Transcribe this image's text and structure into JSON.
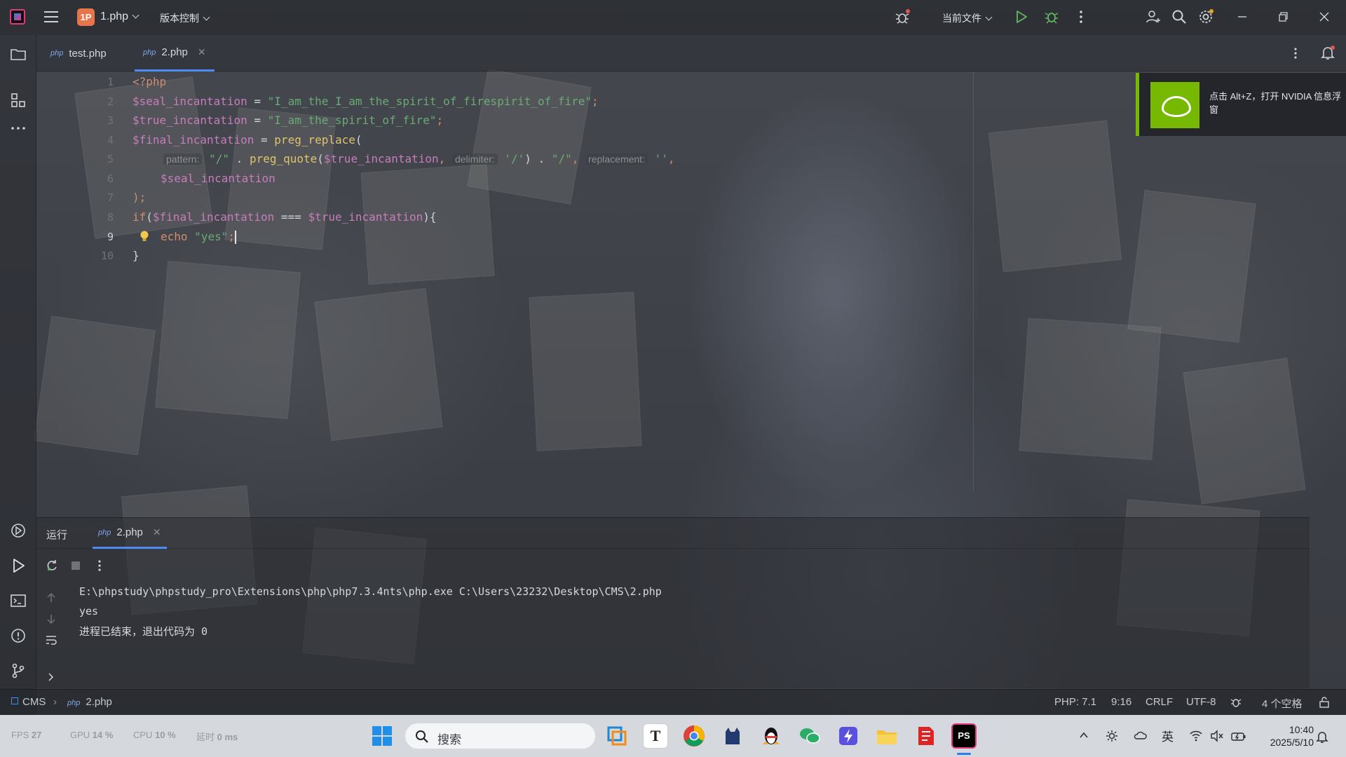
{
  "titlebar": {
    "project_badge": "1P",
    "project_name": "1.php",
    "vcs_label": "版本控制",
    "run_config": "当前文件"
  },
  "editor_tabs": [
    {
      "icon": "php",
      "label": "test.php"
    },
    {
      "icon": "php",
      "label": "2.php"
    }
  ],
  "editor": {
    "line_numbers": [
      "1",
      "2",
      "3",
      "4",
      "5",
      "6",
      "7",
      "8",
      "9",
      "10"
    ],
    "lines": [
      "<?php",
      "$seal_incantation = \"I_am_the_I_am_the_spirit_of_firespirit_of_fire\";",
      "$true_incantation = \"I_am_the_spirit_of_fire\";",
      "$final_incantation = preg_replace(",
      "pattern: \"/\" . preg_quote($true_incantation, delimiter: '/') . \"/\", replacement: '',",
      "$seal_incantation",
      ");",
      "if($final_incantation === $true_incantation){",
      "echo \"yes\";",
      "}"
    ],
    "tokens": {
      "php_open": "<?php",
      "seal_var": "$seal_incantation",
      "true_var": "$true_incantation",
      "final_var": "$final_incantation",
      "eq": " = ",
      "seal_str": "\"I_am_the_I_am_the_spirit_of_firespirit_of_fire\"",
      "true_str": "\"I_am_the_spirit_of_fire\"",
      "semi": ";",
      "preg_replace": "preg_replace",
      "open_paren": "(",
      "hint_pattern": "pattern:",
      "slash_str": "\"/\"",
      "dot": " . ",
      "preg_quote": "preg_quote",
      "comma": ",",
      "hint_delimiter": "delimiter:",
      "slash_sq": "'/'",
      "close_paren": ")",
      "hint_replacement": "replacement:",
      "empty_sq": "''",
      "close_stmt": ");",
      "if_kw": "if",
      "strict_eq": " === ",
      "brace_open": "){",
      "echo_kw": "echo",
      "yes_str": "\"yes\"",
      "brace_close": "}"
    }
  },
  "nvidia_toast": {
    "text": "点击 Alt+Z，打开 NVIDIA 信息浮窗"
  },
  "run_panel": {
    "title": "运行",
    "tab_label": "2.php",
    "output": [
      "E:\\phpstudy\\phpstudy_pro\\Extensions\\php\\php7.3.4nts\\php.exe C:\\Users\\23232\\Desktop\\CMS\\2.php",
      "yes",
      "进程已结束，退出代码为 0"
    ]
  },
  "statusbar": {
    "breadcrumb_project": "CMS",
    "breadcrumb_file": "2.php",
    "php_version": "PHP: 7.1",
    "cursor_pos": "9:16",
    "line_ending": "CRLF",
    "encoding": "UTF-8",
    "indent": "4 个空格"
  },
  "taskbar": {
    "perf": {
      "fps_label": "FPS",
      "fps_value": "27",
      "gpu_label": "GPU",
      "gpu_value": "14 %",
      "cpu_label": "CPU",
      "cpu_value": "10 %",
      "latency_label": "延时",
      "latency_value": "0 ms"
    },
    "search_placeholder": "搜索",
    "ime_label": "英",
    "time": "10:40",
    "date": "2025/5/10"
  },
  "colors": {
    "accent": "#4a8cf0",
    "nvidia_green": "#76b900",
    "keyword": "#cf8e6d",
    "variable": "#c77dbb",
    "string": "#6aab73",
    "function": "#e0c46c"
  }
}
